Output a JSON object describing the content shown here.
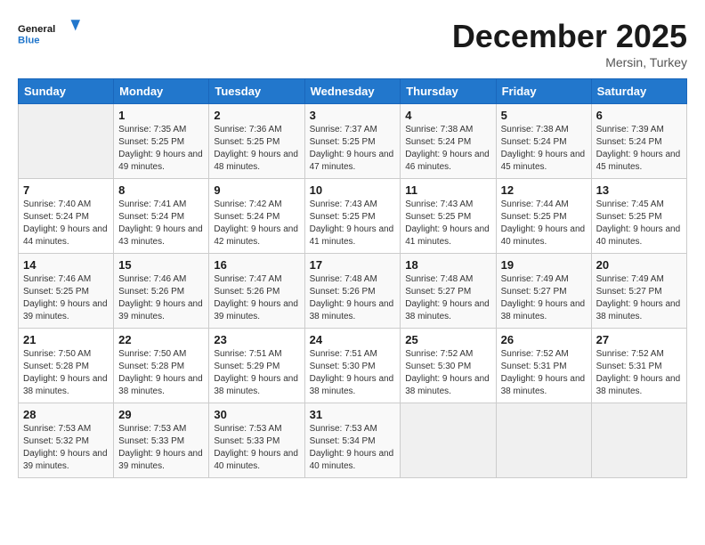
{
  "header": {
    "logo_line1": "General",
    "logo_line2": "Blue",
    "month": "December 2025",
    "location": "Mersin, Turkey"
  },
  "weekdays": [
    "Sunday",
    "Monday",
    "Tuesday",
    "Wednesday",
    "Thursday",
    "Friday",
    "Saturday"
  ],
  "weeks": [
    [
      {
        "day": "",
        "sunrise": "",
        "sunset": "",
        "daylight": ""
      },
      {
        "day": "1",
        "sunrise": "Sunrise: 7:35 AM",
        "sunset": "Sunset: 5:25 PM",
        "daylight": "Daylight: 9 hours and 49 minutes."
      },
      {
        "day": "2",
        "sunrise": "Sunrise: 7:36 AM",
        "sunset": "Sunset: 5:25 PM",
        "daylight": "Daylight: 9 hours and 48 minutes."
      },
      {
        "day": "3",
        "sunrise": "Sunrise: 7:37 AM",
        "sunset": "Sunset: 5:25 PM",
        "daylight": "Daylight: 9 hours and 47 minutes."
      },
      {
        "day": "4",
        "sunrise": "Sunrise: 7:38 AM",
        "sunset": "Sunset: 5:24 PM",
        "daylight": "Daylight: 9 hours and 46 minutes."
      },
      {
        "day": "5",
        "sunrise": "Sunrise: 7:38 AM",
        "sunset": "Sunset: 5:24 PM",
        "daylight": "Daylight: 9 hours and 45 minutes."
      },
      {
        "day": "6",
        "sunrise": "Sunrise: 7:39 AM",
        "sunset": "Sunset: 5:24 PM",
        "daylight": "Daylight: 9 hours and 45 minutes."
      }
    ],
    [
      {
        "day": "7",
        "sunrise": "Sunrise: 7:40 AM",
        "sunset": "Sunset: 5:24 PM",
        "daylight": "Daylight: 9 hours and 44 minutes."
      },
      {
        "day": "8",
        "sunrise": "Sunrise: 7:41 AM",
        "sunset": "Sunset: 5:24 PM",
        "daylight": "Daylight: 9 hours and 43 minutes."
      },
      {
        "day": "9",
        "sunrise": "Sunrise: 7:42 AM",
        "sunset": "Sunset: 5:24 PM",
        "daylight": "Daylight: 9 hours and 42 minutes."
      },
      {
        "day": "10",
        "sunrise": "Sunrise: 7:43 AM",
        "sunset": "Sunset: 5:25 PM",
        "daylight": "Daylight: 9 hours and 41 minutes."
      },
      {
        "day": "11",
        "sunrise": "Sunrise: 7:43 AM",
        "sunset": "Sunset: 5:25 PM",
        "daylight": "Daylight: 9 hours and 41 minutes."
      },
      {
        "day": "12",
        "sunrise": "Sunrise: 7:44 AM",
        "sunset": "Sunset: 5:25 PM",
        "daylight": "Daylight: 9 hours and 40 minutes."
      },
      {
        "day": "13",
        "sunrise": "Sunrise: 7:45 AM",
        "sunset": "Sunset: 5:25 PM",
        "daylight": "Daylight: 9 hours and 40 minutes."
      }
    ],
    [
      {
        "day": "14",
        "sunrise": "Sunrise: 7:46 AM",
        "sunset": "Sunset: 5:25 PM",
        "daylight": "Daylight: 9 hours and 39 minutes."
      },
      {
        "day": "15",
        "sunrise": "Sunrise: 7:46 AM",
        "sunset": "Sunset: 5:26 PM",
        "daylight": "Daylight: 9 hours and 39 minutes."
      },
      {
        "day": "16",
        "sunrise": "Sunrise: 7:47 AM",
        "sunset": "Sunset: 5:26 PM",
        "daylight": "Daylight: 9 hours and 39 minutes."
      },
      {
        "day": "17",
        "sunrise": "Sunrise: 7:48 AM",
        "sunset": "Sunset: 5:26 PM",
        "daylight": "Daylight: 9 hours and 38 minutes."
      },
      {
        "day": "18",
        "sunrise": "Sunrise: 7:48 AM",
        "sunset": "Sunset: 5:27 PM",
        "daylight": "Daylight: 9 hours and 38 minutes."
      },
      {
        "day": "19",
        "sunrise": "Sunrise: 7:49 AM",
        "sunset": "Sunset: 5:27 PM",
        "daylight": "Daylight: 9 hours and 38 minutes."
      },
      {
        "day": "20",
        "sunrise": "Sunrise: 7:49 AM",
        "sunset": "Sunset: 5:27 PM",
        "daylight": "Daylight: 9 hours and 38 minutes."
      }
    ],
    [
      {
        "day": "21",
        "sunrise": "Sunrise: 7:50 AM",
        "sunset": "Sunset: 5:28 PM",
        "daylight": "Daylight: 9 hours and 38 minutes."
      },
      {
        "day": "22",
        "sunrise": "Sunrise: 7:50 AM",
        "sunset": "Sunset: 5:28 PM",
        "daylight": "Daylight: 9 hours and 38 minutes."
      },
      {
        "day": "23",
        "sunrise": "Sunrise: 7:51 AM",
        "sunset": "Sunset: 5:29 PM",
        "daylight": "Daylight: 9 hours and 38 minutes."
      },
      {
        "day": "24",
        "sunrise": "Sunrise: 7:51 AM",
        "sunset": "Sunset: 5:30 PM",
        "daylight": "Daylight: 9 hours and 38 minutes."
      },
      {
        "day": "25",
        "sunrise": "Sunrise: 7:52 AM",
        "sunset": "Sunset: 5:30 PM",
        "daylight": "Daylight: 9 hours and 38 minutes."
      },
      {
        "day": "26",
        "sunrise": "Sunrise: 7:52 AM",
        "sunset": "Sunset: 5:31 PM",
        "daylight": "Daylight: 9 hours and 38 minutes."
      },
      {
        "day": "27",
        "sunrise": "Sunrise: 7:52 AM",
        "sunset": "Sunset: 5:31 PM",
        "daylight": "Daylight: 9 hours and 38 minutes."
      }
    ],
    [
      {
        "day": "28",
        "sunrise": "Sunrise: 7:53 AM",
        "sunset": "Sunset: 5:32 PM",
        "daylight": "Daylight: 9 hours and 39 minutes."
      },
      {
        "day": "29",
        "sunrise": "Sunrise: 7:53 AM",
        "sunset": "Sunset: 5:33 PM",
        "daylight": "Daylight: 9 hours and 39 minutes."
      },
      {
        "day": "30",
        "sunrise": "Sunrise: 7:53 AM",
        "sunset": "Sunset: 5:33 PM",
        "daylight": "Daylight: 9 hours and 40 minutes."
      },
      {
        "day": "31",
        "sunrise": "Sunrise: 7:53 AM",
        "sunset": "Sunset: 5:34 PM",
        "daylight": "Daylight: 9 hours and 40 minutes."
      },
      {
        "day": "",
        "sunrise": "",
        "sunset": "",
        "daylight": ""
      },
      {
        "day": "",
        "sunrise": "",
        "sunset": "",
        "daylight": ""
      },
      {
        "day": "",
        "sunrise": "",
        "sunset": "",
        "daylight": ""
      }
    ]
  ]
}
